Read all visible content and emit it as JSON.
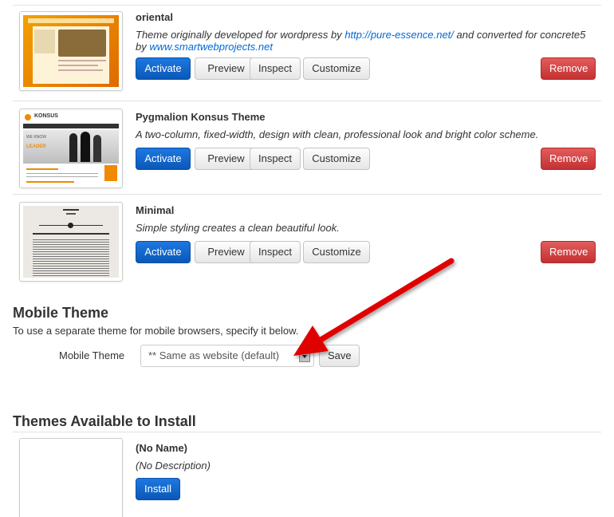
{
  "themes": [
    {
      "name": "oriental",
      "description_prefix": "Theme originally developed for wordpress by ",
      "link1": "http://pure-essence.net/",
      "description_middle": " and converted for concrete5 by ",
      "link2": "www.smartwebprojects.net",
      "buttons": {
        "activate": "Activate",
        "preview": "Preview",
        "inspect": "Inspect",
        "customize": "Customize",
        "remove": "Remove"
      }
    },
    {
      "name": "Pygmalion Konsus Theme",
      "description": "A two-column, fixed-width, design with clean, professional look and bright color scheme.",
      "buttons": {
        "activate": "Activate",
        "preview": "Preview",
        "inspect": "Inspect",
        "customize": "Customize",
        "remove": "Remove"
      }
    },
    {
      "name": "Minimal",
      "description": "Simple styling creates a clean beautiful look.",
      "buttons": {
        "activate": "Activate",
        "preview": "Preview",
        "inspect": "Inspect",
        "customize": "Customize",
        "remove": "Remove"
      }
    }
  ],
  "thumbnail_text": {
    "konsus_logo": "KONSUS",
    "konsus_tagline_1": "WE KNOW",
    "konsus_tagline_2": "LEADER"
  },
  "mobile": {
    "title": "Mobile Theme",
    "subtitle": "To use a separate theme for mobile browsers, specify it below.",
    "field_label": "Mobile Theme",
    "selected": "** Same as website (default)",
    "save": "Save"
  },
  "available": {
    "title": "Themes Available to Install",
    "items": [
      {
        "name": "(No Name)",
        "description": "(No Description)",
        "install": "Install"
      }
    ]
  },
  "colors": {
    "primary": "#0a58b8",
    "danger": "#c43131",
    "link": "#0069d6",
    "annotation_arrow": "#e00000"
  }
}
